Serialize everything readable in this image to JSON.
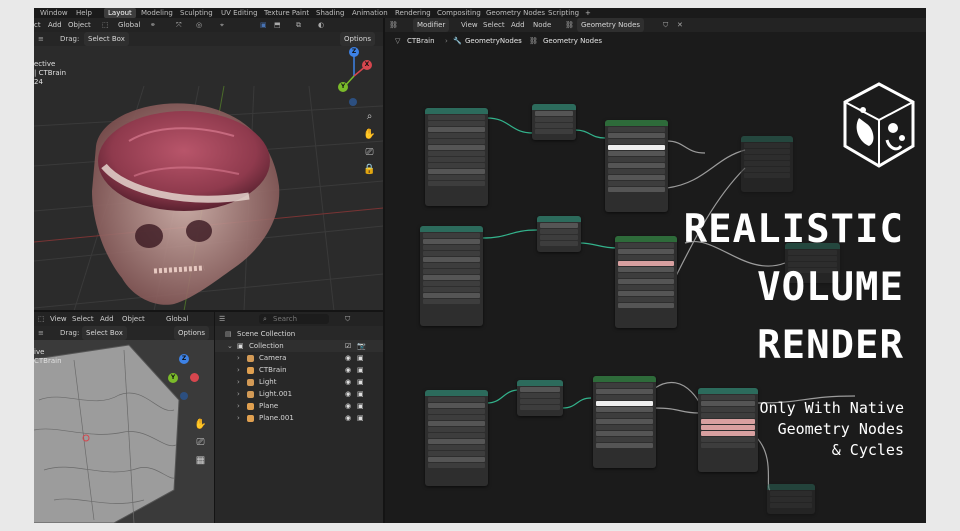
{
  "topbar": {
    "menus": [
      "Window",
      "Help"
    ],
    "workspaces": [
      "Layout",
      "Modeling",
      "Sculpting",
      "UV Editing",
      "Texture Paint",
      "Shading",
      "Animation",
      "Rendering",
      "Compositing",
      "Geometry Nodes",
      "Scripting"
    ],
    "active_workspace": "Layout",
    "add_tab": "+"
  },
  "viewport_top": {
    "header": {
      "select": "ct",
      "add": "Add",
      "object": "Object",
      "orientation": "Global"
    },
    "header2": {
      "drag_label": "Drag:",
      "drag_value": "Select Box",
      "options": "Options"
    },
    "overlay": {
      "line1": "ective",
      "line2": "| CTBrain",
      "line3": "24"
    },
    "gizmo": {
      "x": "X",
      "y": "Y",
      "z": "Z"
    }
  },
  "viewport_bottom": {
    "header": {
      "view": "View",
      "select": "Select",
      "add": "Add",
      "object": "Object",
      "orientation": "Global"
    },
    "header2": {
      "drag_label": "Drag:",
      "drag_value": "Select Box",
      "options": "Options"
    },
    "overlay": {
      "line1": "ive",
      "line2": "CTBrain"
    },
    "gizmo": {
      "y": "Y",
      "z": "Z"
    }
  },
  "outliner": {
    "search_placeholder": "Search",
    "scene_collection": "Scene Collection",
    "collection": "Collection",
    "items": [
      {
        "name": "Camera",
        "color": "#d39a56"
      },
      {
        "name": "CTBrain",
        "color": "#e0a050"
      },
      {
        "name": "Light",
        "color": "#d39a56"
      },
      {
        "name": "Light.001",
        "color": "#d39a56"
      },
      {
        "name": "Plane",
        "color": "#e0a050"
      },
      {
        "name": "Plane.001",
        "color": "#e0a050"
      }
    ]
  },
  "node_editor": {
    "header": {
      "mode": "Modifier",
      "view": "View",
      "select": "Select",
      "add": "Add",
      "node": "Node",
      "tree_name": "Geometry Nodes"
    },
    "breadcrumb": [
      "CTBrain",
      "GeometryNodes",
      "Geometry Nodes"
    ]
  },
  "title": {
    "line1": "REALISTIC",
    "line2": "VOLUME",
    "line3": "RENDER",
    "sub1": "Only With Native",
    "sub2": "Geometry Nodes",
    "sub3": "& Cycles"
  },
  "colors": {
    "accent_blue": "#4772b3",
    "node_green": "#2c6b5c",
    "gizmo_x": "#d6464e",
    "gizmo_y": "#7bbb2a",
    "gizmo_z": "#3d82e6"
  }
}
